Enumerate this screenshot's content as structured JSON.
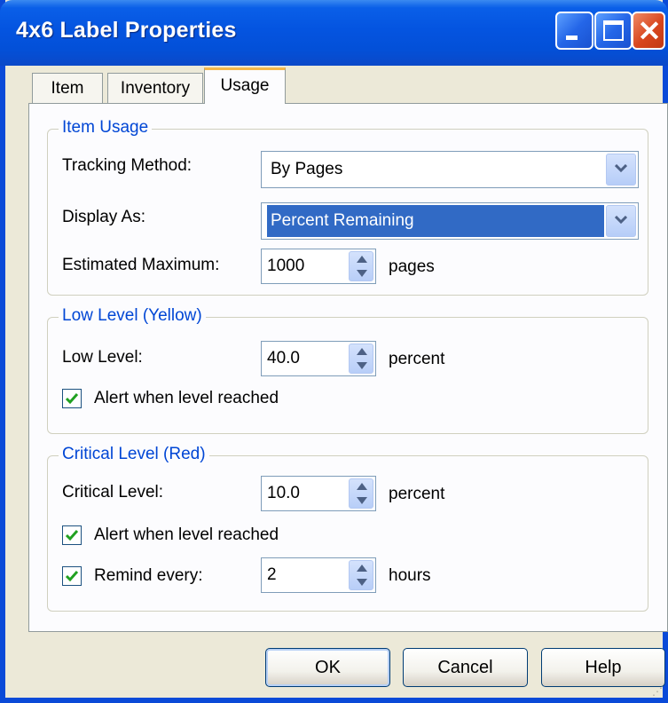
{
  "window": {
    "title": "4x6 Label Properties"
  },
  "tabs": [
    {
      "label": "Item"
    },
    {
      "label": "Inventory"
    },
    {
      "label": "Usage",
      "selected": true
    }
  ],
  "item_usage": {
    "legend": "Item Usage",
    "tracking_method": {
      "label": "Tracking Method:",
      "value": "By Pages"
    },
    "display_as": {
      "label": "Display As:",
      "value": "Percent Remaining"
    },
    "estimated_maximum": {
      "label": "Estimated Maximum:",
      "value": "1000",
      "unit": "pages"
    }
  },
  "low_level": {
    "legend": "Low Level (Yellow)",
    "level": {
      "label": "Low Level:",
      "value": "40.0",
      "unit": "percent"
    },
    "alert": {
      "label": "Alert when level reached",
      "checked": true
    }
  },
  "critical_level": {
    "legend": "Critical Level (Red)",
    "level": {
      "label": "Critical Level:",
      "value": "10.0",
      "unit": "percent"
    },
    "alert": {
      "label": "Alert when level reached",
      "checked": true
    },
    "remind": {
      "label": "Remind every:",
      "checked": true,
      "value": "2",
      "unit": "hours"
    }
  },
  "buttons": {
    "ok": "OK",
    "cancel": "Cancel",
    "help": "Help"
  },
  "colors": {
    "titlebar": "#0454e0",
    "legend_text": "#0046d5",
    "selection": "#316ac5",
    "check": "#21a121"
  }
}
